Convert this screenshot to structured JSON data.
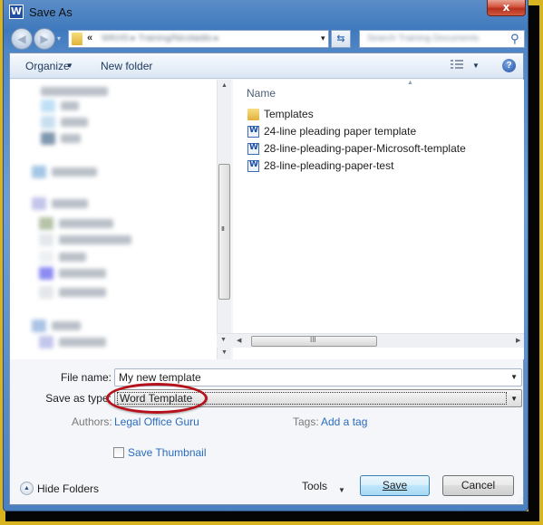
{
  "window": {
    "title": "Save As",
    "app_icon": "word-icon",
    "close_label": "x"
  },
  "navigation": {
    "back_icon": "arrow-left-icon",
    "forward_icon": "arrow-right-icon",
    "history_caret": "▾",
    "address_prefix": "«",
    "address_path": "WKHS ▸ Training/Nicolaidis ▸",
    "address_dropdown": "▾",
    "refresh_icon": "refresh-icon",
    "search_placeholder": "Search Training Documents",
    "search_icon": "⚲"
  },
  "toolbar": {
    "organize_label": "Organize",
    "organize_caret": "▼",
    "new_folder_label": "New folder",
    "view_caret": "▼",
    "help_label": "?"
  },
  "file_list": {
    "column_header": "Name",
    "sort_indicator": "▲",
    "items": [
      {
        "name": "Templates",
        "type": "folder"
      },
      {
        "name": "24-line pleading paper template",
        "type": "word-document"
      },
      {
        "name": "28-line-pleading-paper-Microsoft-template",
        "type": "word-document"
      },
      {
        "name": "28-line-pleading-paper-test",
        "type": "word-document"
      }
    ]
  },
  "scrollbars": {
    "up": "▲",
    "down": "▼",
    "left": "◀",
    "right": "▶",
    "grip": "III"
  },
  "form": {
    "file_name_label": "File name:",
    "file_name_value": "My new template",
    "save_as_type_label": "Save as type:",
    "save_as_type_value": "Word Template",
    "authors_label": "Authors:",
    "authors_value": "Legal Office Guru",
    "tags_label": "Tags:",
    "tags_value": "Add a tag",
    "save_thumbnail_label": "Save Thumbnail",
    "save_thumbnail_checked": false,
    "dropdown_caret": "▼"
  },
  "footer": {
    "hide_folders_label": "Hide Folders",
    "hide_folders_icon": "▲",
    "tools_label": "Tools",
    "tools_caret": "▼",
    "save_label": "Save",
    "cancel_label": "Cancel"
  },
  "annotation": {
    "highlight_color": "#b5121b",
    "target": "save-as-type"
  }
}
